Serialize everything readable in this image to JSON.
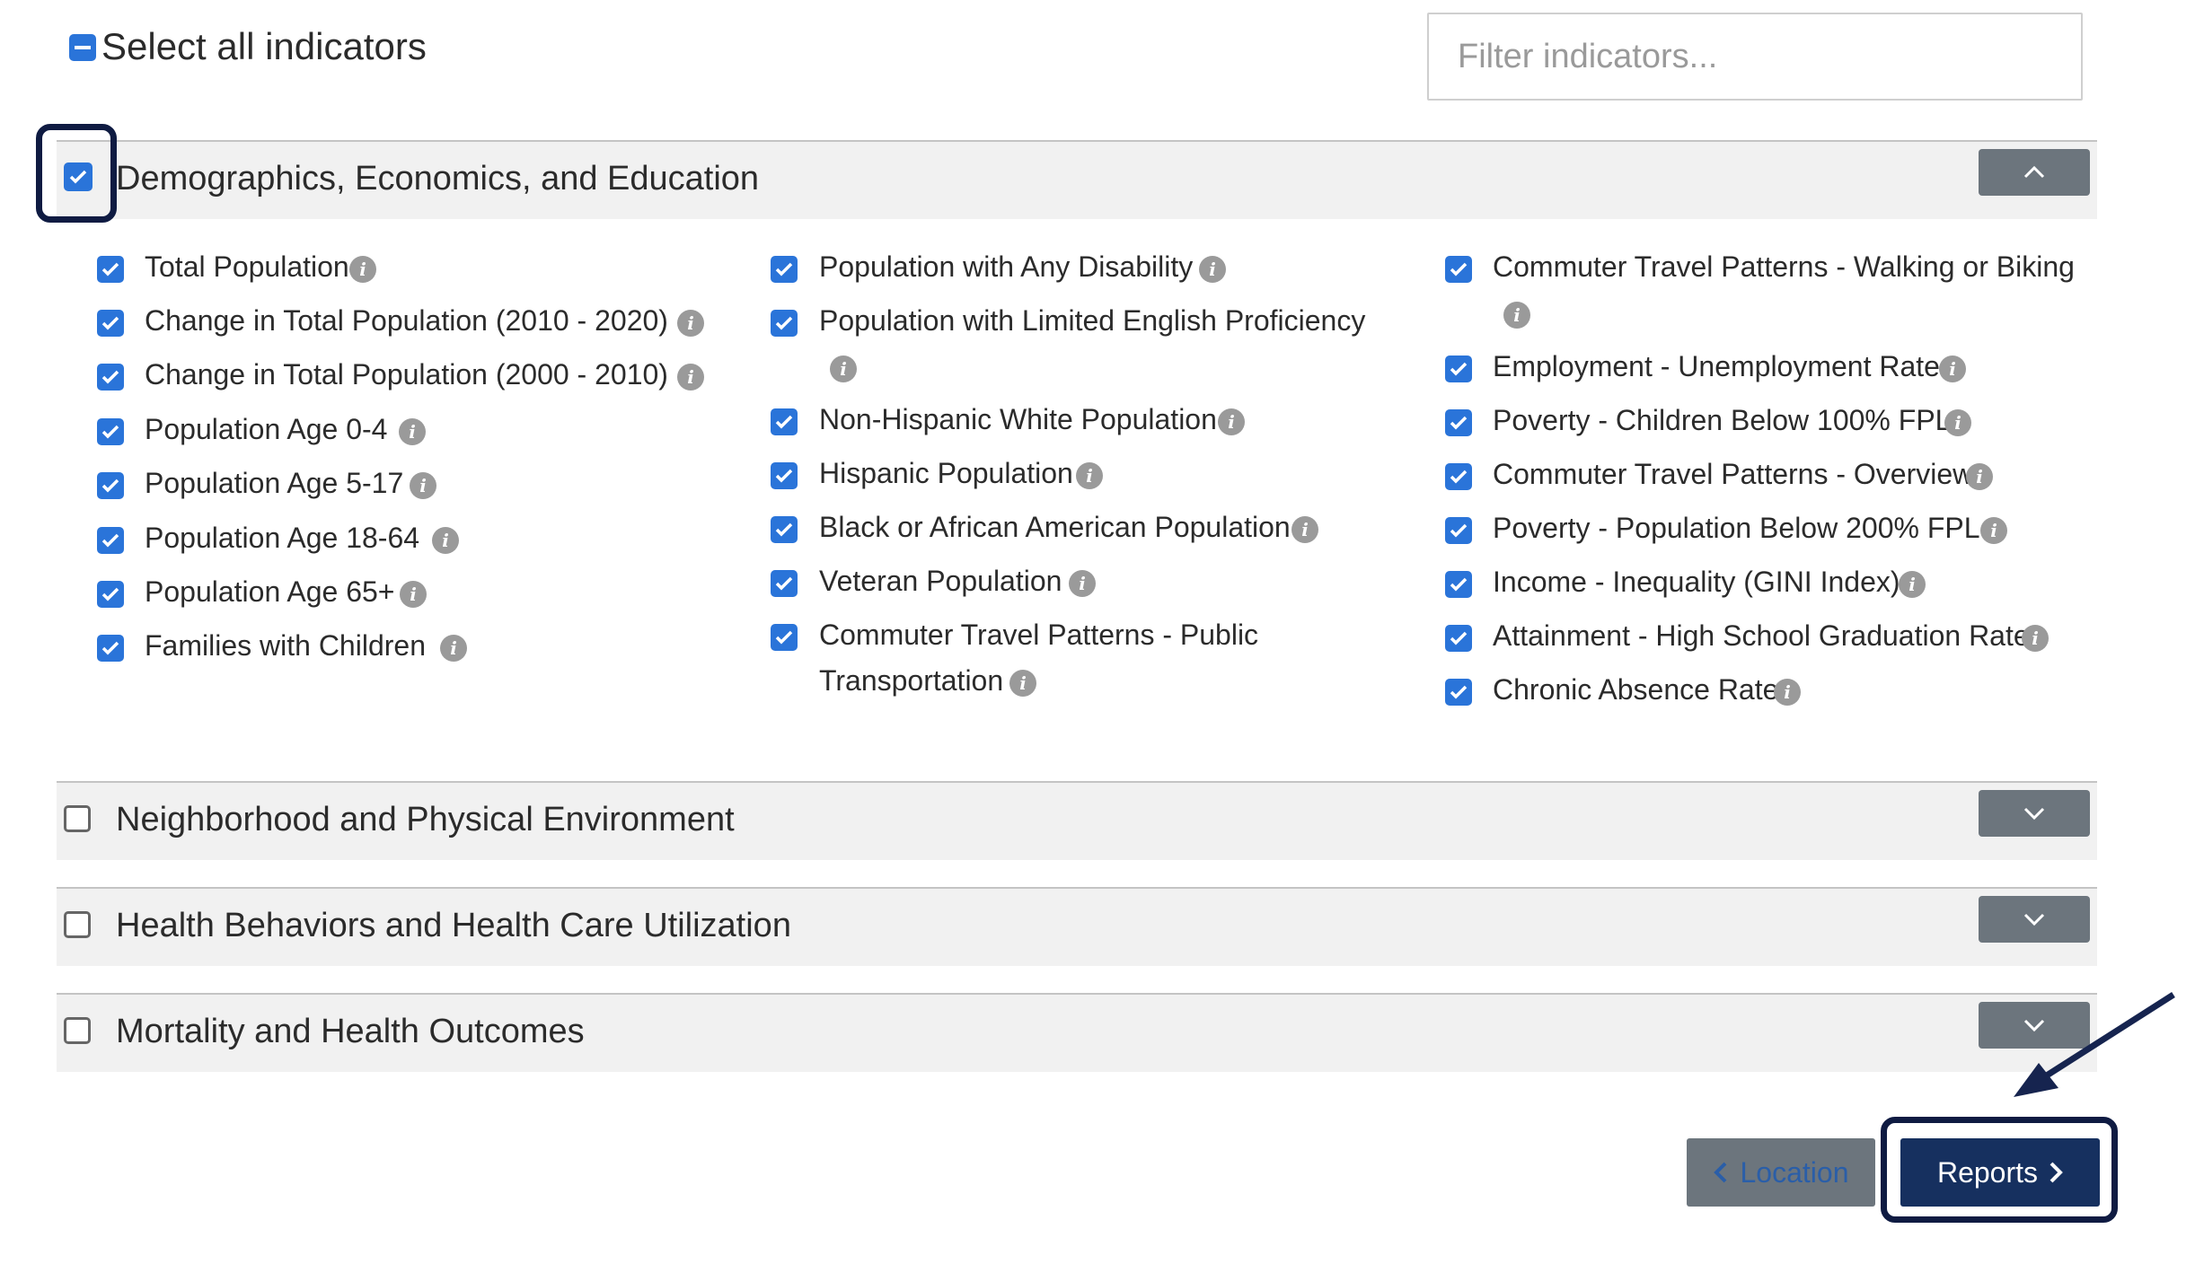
{
  "select_all": {
    "label": "Select all indicators",
    "state": "indeterminate"
  },
  "filter": {
    "placeholder": "Filter indicators...",
    "value": ""
  },
  "sections": [
    {
      "title": "Demographics, Economics, and Education",
      "checked": true,
      "expanded": true
    },
    {
      "title": "Neighborhood and Physical Environment",
      "checked": false,
      "expanded": false
    },
    {
      "title": "Health Behaviors and Health Care Utilization",
      "checked": false,
      "expanded": false
    },
    {
      "title": "Mortality and Health Outcomes",
      "checked": false,
      "expanded": false
    }
  ],
  "indicators": {
    "col1": [
      "Total Population",
      "Change in Total Population (2010 - 2020)",
      "Change in Total Population (2000 - 2010)",
      "Population Age 0-4",
      "Population Age 5-17",
      "Population Age 18-64",
      "Population Age 65+",
      "Families with Children"
    ],
    "col2": [
      "Population with Any Disability",
      "Population with Limited English Proficiency",
      "Non-Hispanic White Population",
      "Hispanic Population",
      "Black or African American Population",
      "Veteran Population",
      "Commuter Travel Patterns - Public Transportation"
    ],
    "col2_wrapped": {
      "limited_english": "Population with Limited English Proficiency",
      "public_transport_line1": "Commuter Travel Patterns - Public",
      "public_transport_line2": "Transportation"
    },
    "col3": [
      "Commuter Travel Patterns - Walking or Biking",
      "Employment - Unemployment Rate",
      "Poverty - Children Below 100% FPL",
      "Commuter Travel Patterns - Overview",
      "Poverty - Population Below 200% FPL",
      "Income - Inequality (GINI Index)",
      "Attainment - High School Graduation Rate",
      "Chronic Absence Rate"
    ]
  },
  "footer": {
    "location_label": "Location",
    "reports_label": "Reports"
  },
  "colors": {
    "checkbox": "#2a74d9",
    "primary_button": "#16305f",
    "secondary_button": "#6c757d",
    "highlight": "#0f1b42"
  }
}
